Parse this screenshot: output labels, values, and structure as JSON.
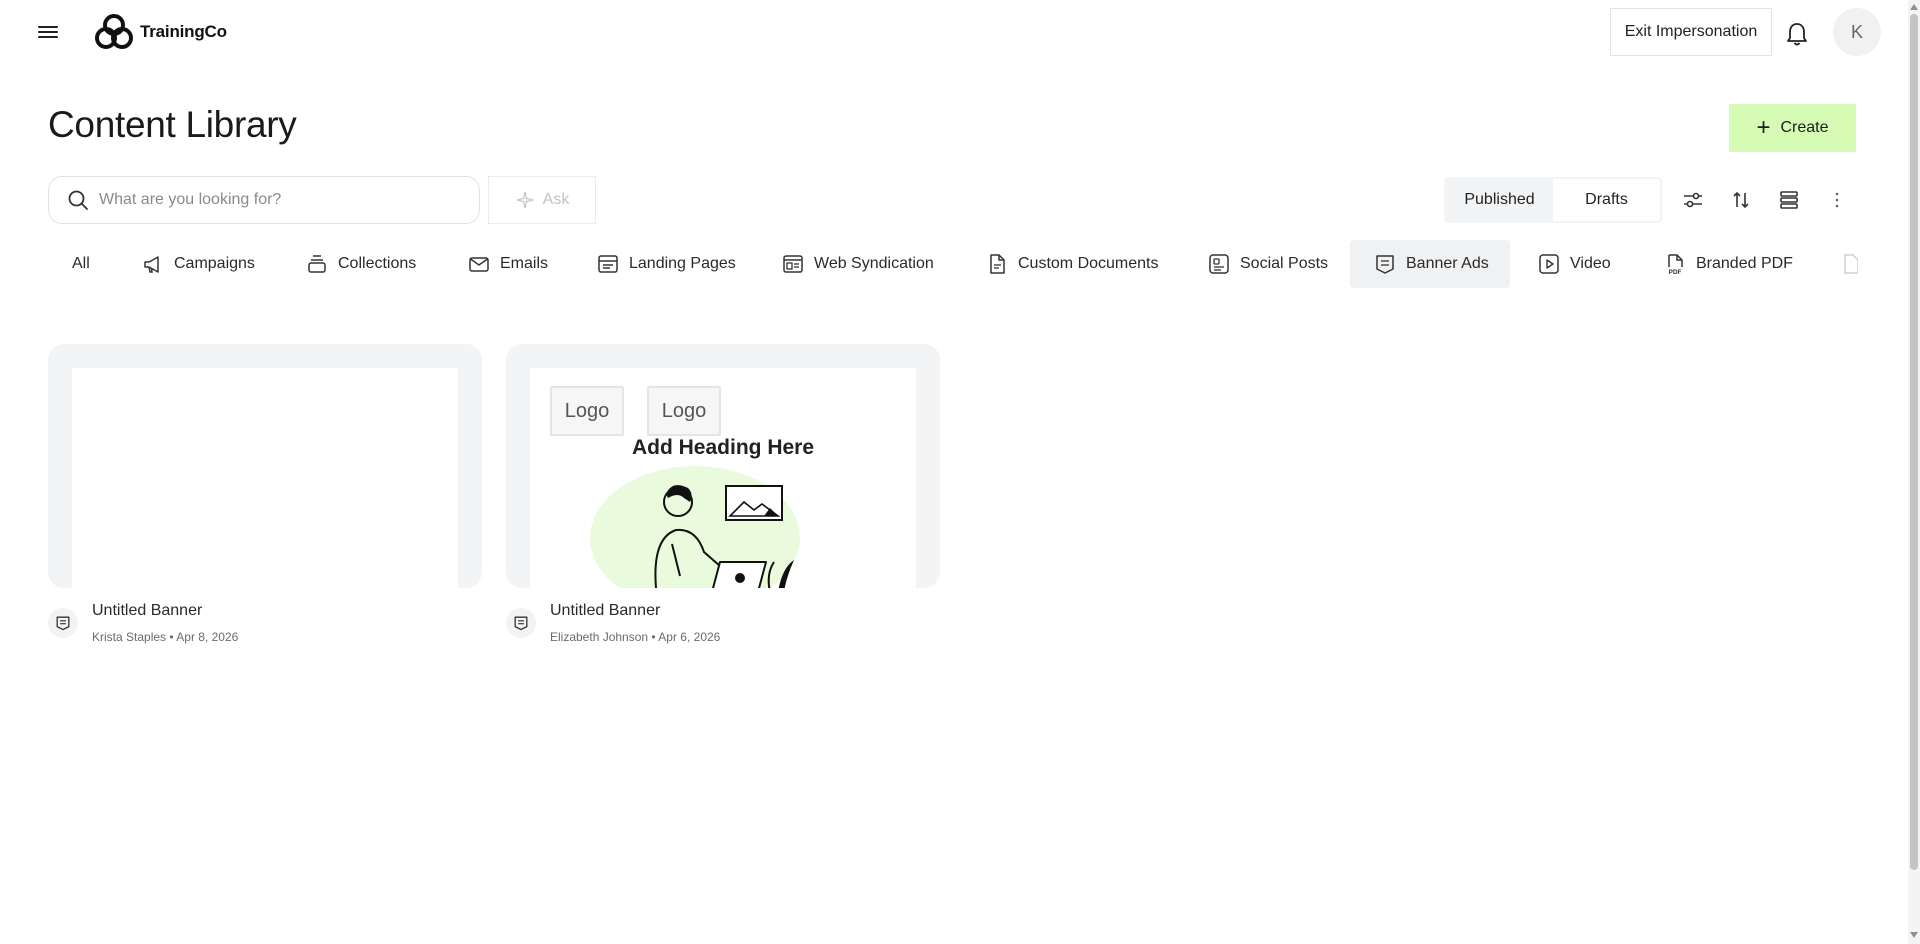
{
  "header": {
    "brand": "TrainingCo",
    "exit_impersonation_label": "Exit Impersonation",
    "avatar_initial": "K"
  },
  "page": {
    "title": "Content Library",
    "create_label": "Create"
  },
  "search": {
    "placeholder": "What are you looking for?",
    "value": "",
    "ask_label": "Ask"
  },
  "status_toggle": {
    "published_label": "Published",
    "drafts_label": "Drafts",
    "selected": "Published"
  },
  "toolbar": {
    "icons": [
      "filter-sliders-icon",
      "sort-icon",
      "view-list-icon",
      "more-vertical-icon"
    ]
  },
  "tabs": [
    {
      "label": "All",
      "icon": ""
    },
    {
      "label": "Campaigns",
      "icon": "megaphone-icon"
    },
    {
      "label": "Collections",
      "icon": "stack-icon"
    },
    {
      "label": "Emails",
      "icon": "envelope-icon"
    },
    {
      "label": "Landing Pages",
      "icon": "browser-page-icon"
    },
    {
      "label": "Web Syndication",
      "icon": "web-syndication-icon"
    },
    {
      "label": "Custom Documents",
      "icon": "document-icon"
    },
    {
      "label": "Social Posts",
      "icon": "social-post-icon"
    },
    {
      "label": "Banner Ads",
      "icon": "banner-icon"
    },
    {
      "label": "Video",
      "icon": "play-icon"
    },
    {
      "label": "Branded PDF",
      "icon": "pdf-icon"
    }
  ],
  "active_tab": "Banner Ads",
  "cards": [
    {
      "title": "Untitled Banner",
      "author": "Krista Staples",
      "date": "Apr 8, 2026",
      "preview": "blank"
    },
    {
      "title": "Untitled Banner",
      "author": "Elizabeth Johnson",
      "date": "Apr 6, 2026",
      "preview": "banner",
      "preview_logos": [
        "Logo",
        "Logo"
      ],
      "preview_heading": "Add Heading Here"
    }
  ],
  "colors": {
    "create_button_bg": "#d6fbb4",
    "active_tab_bg": "#f0f1f3",
    "illustration_accent": "#e2fad0"
  }
}
